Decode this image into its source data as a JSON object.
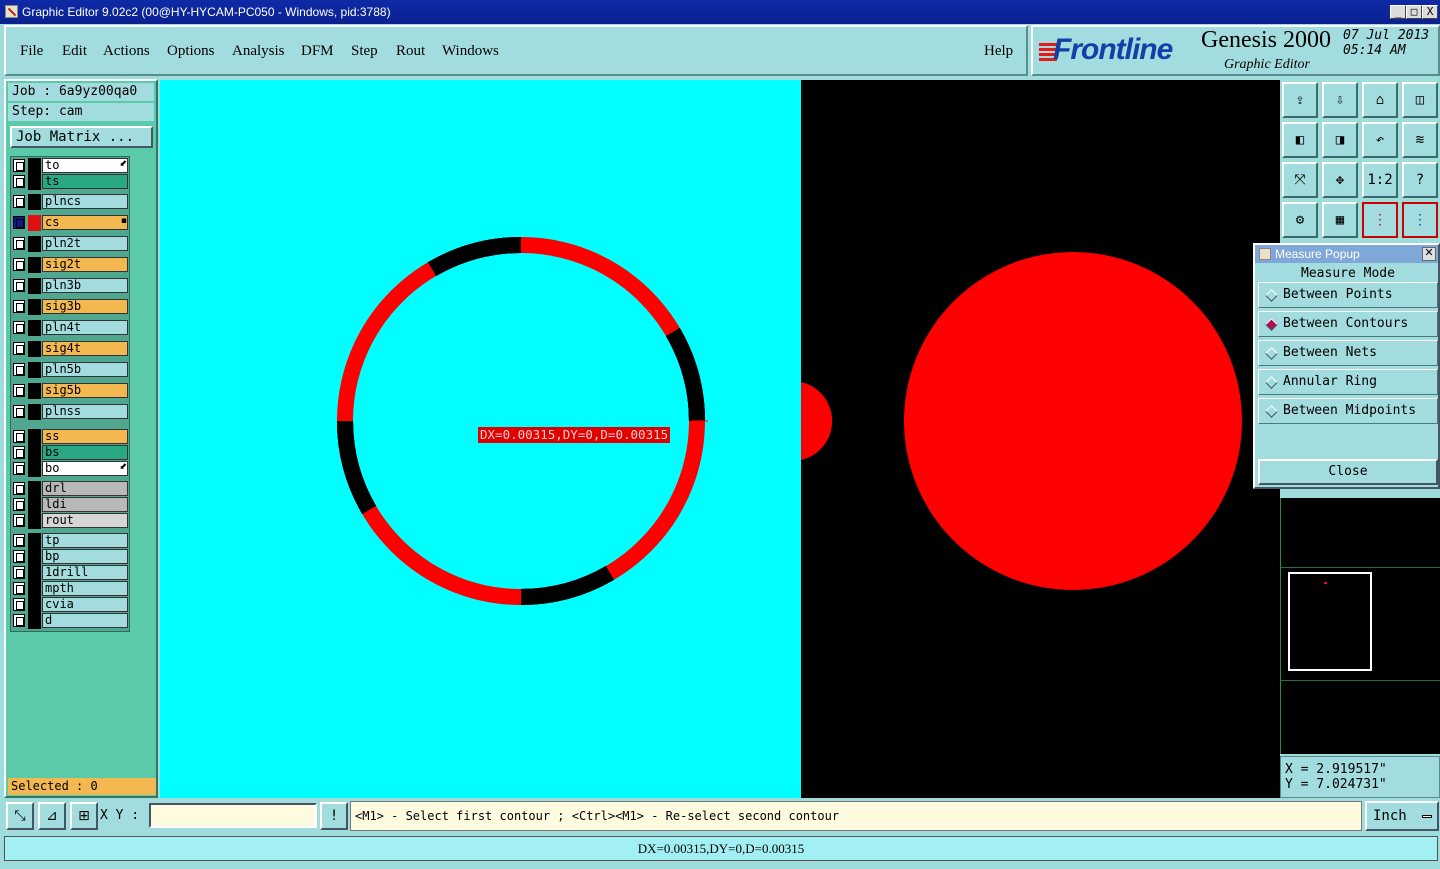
{
  "window": {
    "title": "Graphic Editor 9.02c2 (00@HY-HYCAM-PC050 - Windows, pid:3788)",
    "controls": [
      "_",
      "□",
      "X"
    ]
  },
  "menu": [
    "File",
    "Edit",
    "Actions",
    "Options",
    "Analysis",
    "DFM",
    "Step",
    "Rout",
    "Windows"
  ],
  "help": "Help",
  "brand": {
    "logo": "Frontline",
    "product": "Genesis 2000",
    "subtitle": "Graphic Editor",
    "date": "07 Jul 2013",
    "time": "05:14 AM"
  },
  "job": {
    "job_line": "Job : 6a9yz00qa0",
    "step_line": "Step: cam",
    "matrix_button": "Job Matrix ..."
  },
  "layers": [
    {
      "name": "to",
      "bg": "#ffffff",
      "mark": "⬋"
    },
    {
      "name": "ts",
      "bg": "#2aa884",
      "mark": ""
    },
    {
      "name": "plncs",
      "bg": "#a3dcde",
      "mark": ""
    },
    {
      "name": "cs",
      "bg": "#f4b850",
      "mark": "▪",
      "active": true
    },
    {
      "name": "pln2t",
      "bg": "#a3dcde",
      "mark": ""
    },
    {
      "name": "sig2t",
      "bg": "#f4b850",
      "mark": ""
    },
    {
      "name": "pln3b",
      "bg": "#a3dcde",
      "mark": ""
    },
    {
      "name": "sig3b",
      "bg": "#f4b850",
      "mark": ""
    },
    {
      "name": "pln4t",
      "bg": "#a3dcde",
      "mark": ""
    },
    {
      "name": "sig4t",
      "bg": "#f4b850",
      "mark": ""
    },
    {
      "name": "pln5b",
      "bg": "#a3dcde",
      "mark": ""
    },
    {
      "name": "sig5b",
      "bg": "#f4b850",
      "mark": ""
    },
    {
      "name": "plnss",
      "bg": "#a3dcde",
      "mark": ""
    },
    {
      "name": "ss",
      "bg": "#f4b850",
      "mark": ""
    },
    {
      "name": "bs",
      "bg": "#2aa884",
      "mark": ""
    },
    {
      "name": "bo",
      "bg": "#ffffff",
      "mark": "⬋"
    },
    {
      "name": "drl",
      "bg": "#b8b8b8",
      "mark": ""
    },
    {
      "name": "ldi",
      "bg": "#b8b8b8",
      "mark": ""
    },
    {
      "name": "rout",
      "bg": "#d6d6d6",
      "mark": ""
    },
    {
      "name": "tp",
      "bg": "#a3dcde",
      "mark": ""
    },
    {
      "name": "bp",
      "bg": "#a3dcde",
      "mark": ""
    },
    {
      "name": "1drill",
      "bg": "#a3dcde",
      "mark": ""
    },
    {
      "name": "mpth",
      "bg": "#a3dcde",
      "mark": ""
    },
    {
      "name": "cvia",
      "bg": "#a3dcde",
      "mark": ""
    },
    {
      "name": "d",
      "bg": "#a3dcde",
      "mark": ""
    }
  ],
  "selected": "Selected : 0",
  "canvas": {
    "measure_label": "DX=0.00315,DY=0,D=0.00315",
    "colors": {
      "cyan": "#00ffff",
      "red": "#ff0000",
      "black": "#000000"
    }
  },
  "toolbar_icons": [
    "zoom-home-icon",
    "zoom-fit-icon",
    "house-icon",
    "window-icon",
    "pan-left-icon",
    "pan-right-icon",
    "undo-zoom-icon",
    "redraw-icon",
    "zoom-in-icon",
    "zoom-out-icon",
    "one-to-two-icon",
    "help-icon",
    "tools-icon",
    "grid-icon",
    "layers-red-icon",
    "layers-blue-icon"
  ],
  "toolbar_labels": {
    "ratio": "1:2",
    "help": "?"
  },
  "measure": {
    "title": "Measure Popup",
    "header": "Measure Mode",
    "options": [
      "Between Points",
      "Between Contours",
      "Between Nets",
      "Annular Ring",
      "Between Midpoints"
    ],
    "selected_index": 1,
    "close": "Close"
  },
  "coords": {
    "x": "X = 2.919517\"",
    "y": "Y = 7.024731\""
  },
  "bottom": {
    "xy_label": "X Y :",
    "xy_value": "",
    "prompt": "<M1> - Select first contour ; <Ctrl><M1> - Re-select second contour",
    "units": "Inch",
    "status": "DX=0.00315,DY=0,D=0.00315"
  }
}
